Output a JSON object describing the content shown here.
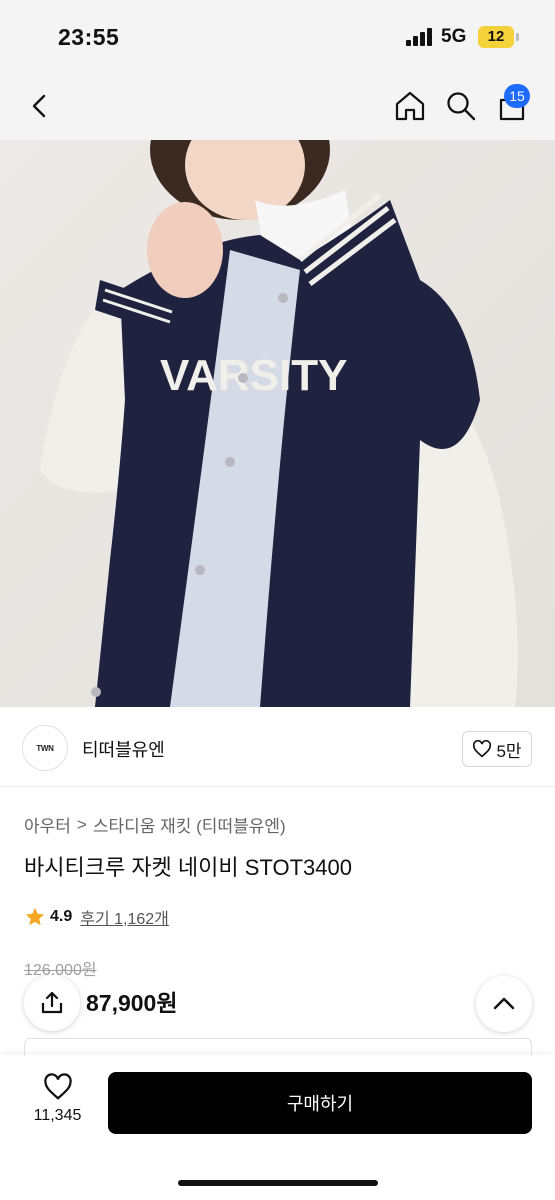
{
  "status_bar": {
    "time": "23:55",
    "network": "5G",
    "battery": "12"
  },
  "nav": {
    "cart_count": "15",
    "icons": [
      "chevron-left-icon",
      "home-icon",
      "search-icon",
      "shopping-bag-icon"
    ]
  },
  "product_image": {
    "text": "VARSITY"
  },
  "brand": {
    "logo_text": "TWN",
    "name": "티떠블유엔",
    "likes": "5만"
  },
  "breadcrumb": {
    "category": "아우터",
    "separator": ">",
    "subcategory": "스타디움 재킷 (티떠블유엔)"
  },
  "product": {
    "title": "바시티크루 자켓 네이비 STOT3400"
  },
  "rating": {
    "value": "4.9",
    "reviews": "후기 1,162개"
  },
  "price": {
    "original": "126,000원",
    "sale": "87,900원"
  },
  "bottom_bar": {
    "wish_count": "11,345",
    "buy_label": "구매하기"
  },
  "colors": {
    "accent_blue": "#1e6bff",
    "star": "#f5a623",
    "jacket_navy": "#1f2340"
  }
}
